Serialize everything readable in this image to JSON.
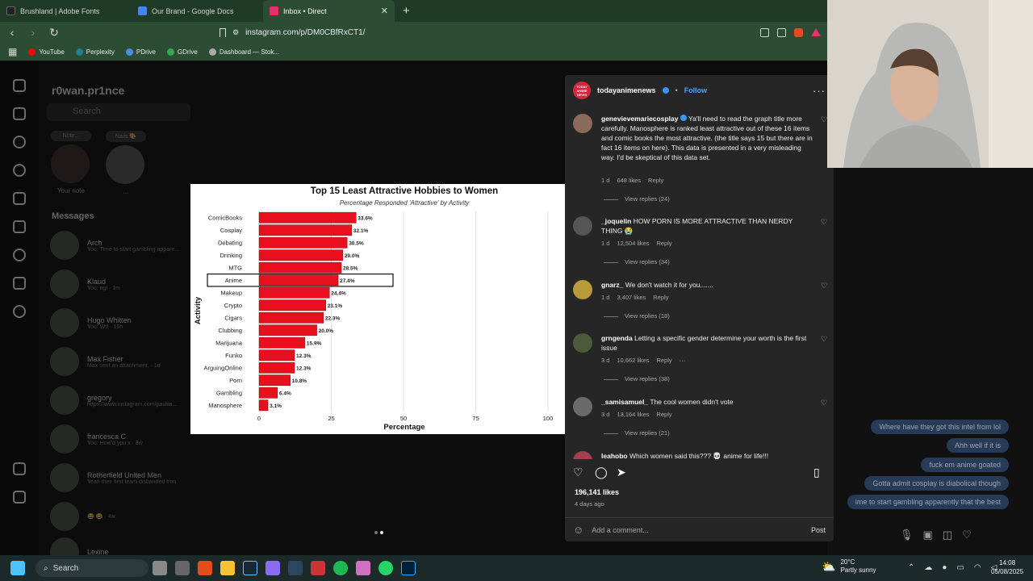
{
  "tabs": [
    {
      "label": "Brushland | Adobe Fonts",
      "color": "#222222",
      "active": false
    },
    {
      "label": "Our Brand - Google Docs",
      "color": "#4285f4",
      "active": false
    },
    {
      "label": "Inbox • Direct",
      "color": "#e1306c",
      "active": true
    }
  ],
  "url": "instagram.com/p/DM0CBfRxCT1/",
  "bookmarks": [
    {
      "label": "YouTube",
      "color": "#ff0000"
    },
    {
      "label": "Perplexity",
      "color": "#20808d"
    },
    {
      "label": "PDrive",
      "color": "#4a90e2"
    },
    {
      "label": "GDrive",
      "color": "#34a853"
    },
    {
      "label": "Dashboard — Stok...",
      "color": "#aaaaaa"
    }
  ],
  "dm": {
    "username": "r0wan.pr1nce",
    "search_placeholder": "Search",
    "notes": [
      {
        "bubble": "Note...",
        "label": "Your note"
      },
      {
        "bubble": "Nails 🎨",
        "label": "..."
      }
    ],
    "messages_label": "Messages",
    "conversations": [
      {
        "name": "Arch",
        "preview": "You: Time to start gambling appare..."
      },
      {
        "name": "Klaud",
        "preview": "You: ngl · 1m"
      },
      {
        "name": "Hugo Whitten",
        "preview": "You: Wtf · 15h"
      },
      {
        "name": "Max Fisher",
        "preview": "Max sent an attachment. · 1d"
      },
      {
        "name": "gregory",
        "preview": "https://www.instagram.com/paulwi..."
      },
      {
        "name": "francesca C",
        "preview": "You: How'd you x · 3w"
      },
      {
        "name": "Rotherfield United Men",
        "preview": "Yeah their first team disbanded fron"
      },
      {
        "name": "",
        "preview": "😂 😂 · 4w"
      },
      {
        "name": "Lexine",
        "preview": ""
      }
    ]
  },
  "chart_data": {
    "type": "bar",
    "title": "Top 15 Least Attractive Hobbies to Women",
    "subtitle": "Percentage Responded 'Attractive' by Activity",
    "xlabel": "Percentage",
    "ylabel": "Activity",
    "categories": [
      "ComicBooks",
      "Cosplay",
      "Debating",
      "Drinking",
      "MTG",
      "Anime",
      "Makeup",
      "Crypto",
      "Cigars",
      "Clubbing",
      "Marijuana",
      "Funko",
      "ArguingOnline",
      "Porn",
      "Gambling",
      "Manosphere"
    ],
    "values": [
      33.6,
      32.1,
      30.5,
      29.0,
      28.5,
      27.4,
      24.4,
      23.1,
      22.3,
      20.0,
      15.9,
      12.3,
      12.3,
      10.8,
      6.4,
      3.1
    ],
    "labels": [
      "33.6%",
      "32.1%",
      "30.5%",
      "29.0%",
      "28.5%",
      "27.4%",
      "24.4%",
      "23.1%",
      "22.3%",
      "20.0%",
      "15.9%",
      "12.3%",
      "12.3%",
      "10.8%",
      "6.4%",
      "3.1%"
    ],
    "xlim": [
      0,
      100
    ],
    "xticks": [
      "0",
      "25",
      "50",
      "75",
      "100"
    ],
    "highlight": "Anime",
    "bar_color": "#e8101e"
  },
  "post": {
    "account": "todayanimenews",
    "follow": "Follow",
    "logo_text": "TODAY ANIME NEWS",
    "comments": [
      {
        "user": "genevievemariecosplay",
        "text": "Ya'll need to read the graph title more carefully. Manosphere is ranked least attractive out of these 16 items and comic books the most attractive. (the title says 15 but there are in fact 16 items on here). This data is presented in a very misleading way. I'd be skeptical of this data set.",
        "time": "1 d",
        "likes": "648 likes",
        "reply": "Reply",
        "view": "View replies (24)"
      },
      {
        "user": "_joquelin",
        "text": "HOW PORN IS MORE ATTRACTIVE THAN NERDY THING 😭",
        "time": "1 d",
        "likes": "12,504 likes",
        "reply": "Reply",
        "view": "View replies (34)"
      },
      {
        "user": "gnarz_",
        "text": "We don't watch it for you.......",
        "time": "1 d",
        "likes": "3,407 likes",
        "reply": "Reply",
        "view": "View replies (18)"
      },
      {
        "user": "grngenda",
        "text": "Letting a specific gender determine your worth is the first issue",
        "time": "3 d",
        "likes": "10,662 likes",
        "reply": "Reply",
        "view": "View replies (38)"
      },
      {
        "user": "_samisamuel_",
        "text": "The cool women didn't vote",
        "time": "3 d",
        "likes": "13,164 likes",
        "reply": "Reply",
        "view": "View replies (21)"
      },
      {
        "user": "leahobo",
        "text": "Which women said this??? 💀 anime for life!!!",
        "time": "",
        "likes": "",
        "reply": "",
        "view": ""
      }
    ],
    "likes": "196,141 likes",
    "ago": "4 days ago",
    "add_comment": "Add a comment...",
    "post_btn": "Post"
  },
  "chat": [
    "Where have they got this intel from lol",
    "Ahh well if it is",
    "fuck em anime goated",
    "Gotta admit cosplay is diabolical though",
    "ime to start gambling apparently that the best"
  ],
  "taskbar": {
    "search": "Search",
    "weather_temp": "20°C",
    "weather_desc": "Partly sunny",
    "time": "14:08",
    "date": "05/08/2025"
  }
}
